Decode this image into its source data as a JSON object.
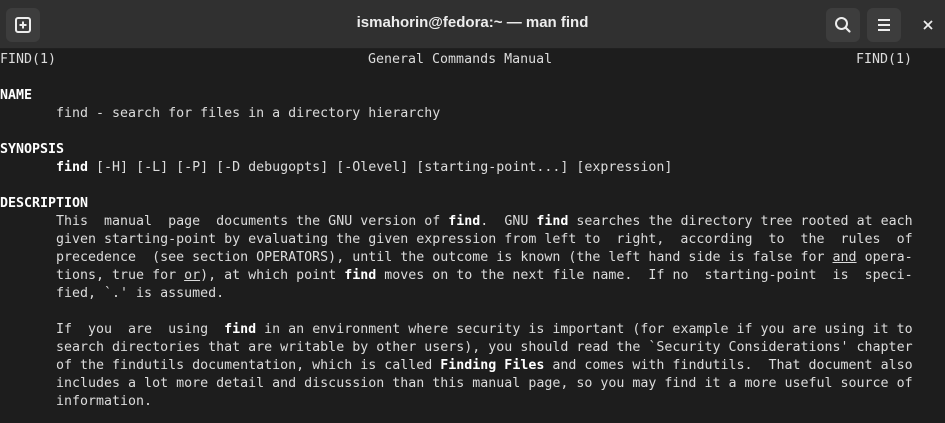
{
  "window": {
    "title": "ismahorin@fedora:~ — man find"
  },
  "titlebar": {
    "new_tab_icon": "new-tab-icon",
    "search_icon": "search-icon",
    "menu_icon": "hamburger-menu-icon",
    "close_icon": "close-icon"
  },
  "man": {
    "header": {
      "left": "FIND(1)",
      "center": "General Commands Manual",
      "right": "FIND(1)"
    },
    "name": {
      "heading": "NAME",
      "text": "find - search for files in a directory hierarchy"
    },
    "synopsis": {
      "heading": "SYNOPSIS",
      "command": "find",
      "args": " [-H] [-L] [-P] [-D debugopts] [-Olevel] [starting-point...] [expression]"
    },
    "description": {
      "heading": "DESCRIPTION",
      "p1": {
        "l1a": "This  manual  page  documents the GNU version of ",
        "l1b": "find",
        "l1c": ".  GNU ",
        "l1d": "find",
        "l1e": " searches the directory tree rooted at each",
        "l2": "given starting-point by evaluating the given expression from left to  right,  according  to  the  rules  of",
        "l3a": "precedence  (see section OPERATORS), until the outcome is known (the left hand side is false for ",
        "l3b": "and",
        "l3c": " opera-",
        "l4a": "tions, true for ",
        "l4b": "or",
        "l4c": "), at which point ",
        "l4d": "find",
        "l4e": " moves on to the next file name.  If no  starting-point  is  speci-",
        "l5": "fied, `.' is assumed."
      },
      "p2": {
        "l1a": "If  you  are  using  ",
        "l1b": "find",
        "l1c": " in an environment where security is important (for example if you are using it to",
        "l2": "search directories that are writable by other users), you should read the `Security Considerations' chapter",
        "l3a": "of the findutils documentation, which is called ",
        "l3b": "Finding Files",
        "l3c": " and comes with findutils.  That document also",
        "l4": "includes a lot more detail and discussion than this manual page, so you may find it a more useful source of",
        "l5": "information."
      }
    }
  }
}
